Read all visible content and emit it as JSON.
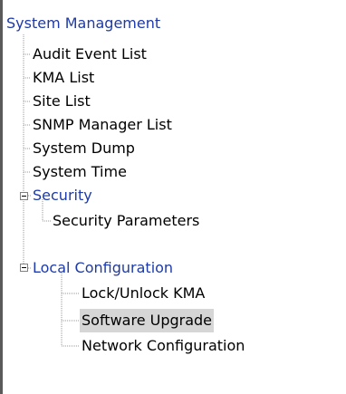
{
  "tree": {
    "root": "System Management",
    "system_items": [
      "Audit Event List",
      "KMA List",
      "Site List",
      "SNMP Manager List",
      "System Dump",
      "System Time"
    ],
    "security": {
      "label": "Security",
      "children": [
        "Security Parameters"
      ]
    },
    "local_configuration": {
      "label": "Local Configuration",
      "children": [
        "Lock/Unlock KMA",
        "Software Upgrade",
        "Network Configuration"
      ],
      "selected": "Software Upgrade"
    }
  },
  "colors": {
    "folder_text": "#1d3aa8",
    "selection_bg": "#d6d6d6",
    "tree_line": "#9a9a9a"
  }
}
